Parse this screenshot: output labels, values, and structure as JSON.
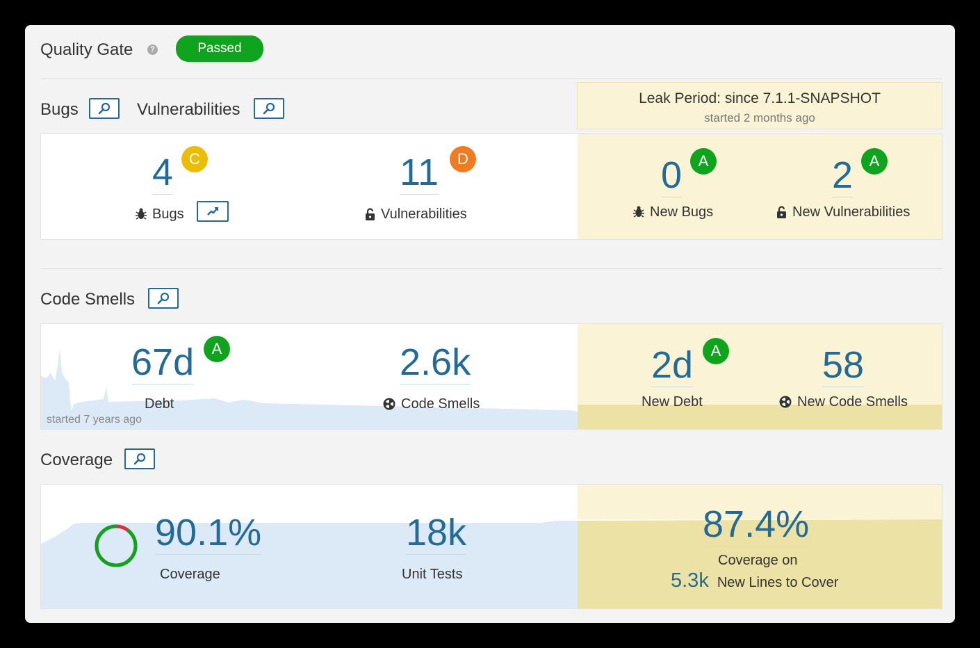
{
  "quality_gate": {
    "title": "Quality Gate",
    "status": "Passed",
    "status_color": "#0fa31e"
  },
  "sections": {
    "bugs_title": "Bugs",
    "vulnerabilities_title": "Vulnerabilities",
    "code_smells_title": "Code Smells",
    "coverage_title": "Coverage"
  },
  "leak_period": {
    "title": "Leak Period: since 7.1.1-SNAPSHOT",
    "subtitle": "started 2 months ago"
  },
  "bugs": {
    "value": "4",
    "rating": "C",
    "label": "Bugs"
  },
  "vulnerabilities": {
    "value": "11",
    "rating": "D",
    "label": "Vulnerabilities"
  },
  "new_bugs": {
    "value": "0",
    "rating": "A",
    "label": "New Bugs"
  },
  "new_vulnerabilities": {
    "value": "2",
    "rating": "A",
    "label": "New Vulnerabilities"
  },
  "debt": {
    "value": "67d",
    "rating": "A",
    "label": "Debt",
    "history_note": "started 7 years ago"
  },
  "code_smells": {
    "value": "2.6k",
    "label": "Code Smells"
  },
  "new_debt": {
    "value": "2d",
    "rating": "A",
    "label": "New Debt"
  },
  "new_code_smells": {
    "value": "58",
    "label": "New Code Smells"
  },
  "coverage": {
    "value": "90.1%",
    "label": "Coverage",
    "fraction": 0.901
  },
  "unit_tests": {
    "value": "18k",
    "label": "Unit Tests"
  },
  "new_coverage": {
    "value": "87.4%",
    "label_line1": "Coverage on",
    "new_lines_value": "5.3k",
    "new_lines_label": "New Lines to Cover"
  },
  "colors": {
    "accent": "#236a97",
    "rating_a": "#0fa31e",
    "rating_c": "#eabe06",
    "rating_d": "#ed7d20",
    "leak_background": "#fbf3d5"
  }
}
